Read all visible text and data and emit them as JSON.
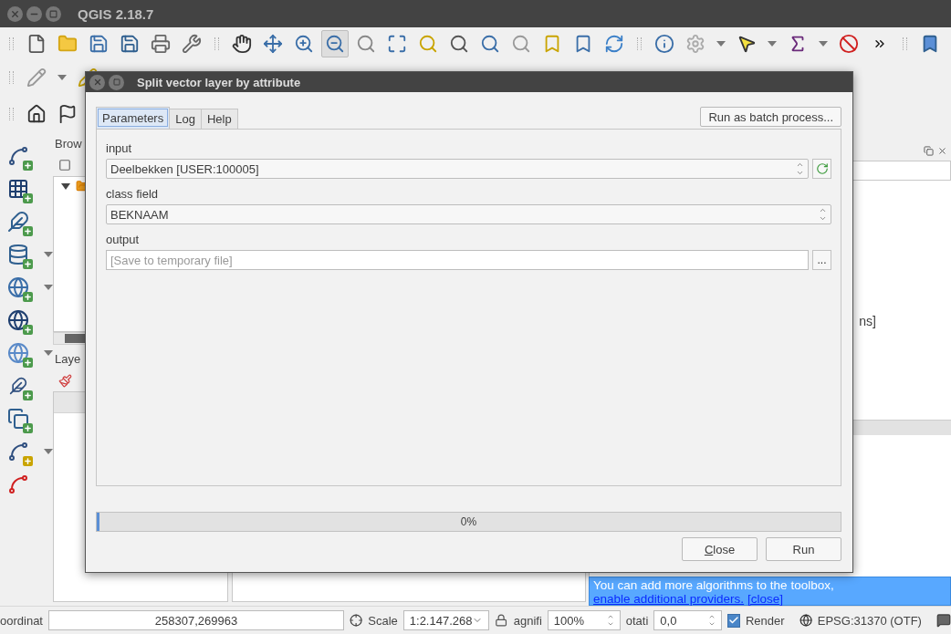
{
  "window": {
    "title": "QGIS 2.18.7"
  },
  "main_toolbar": {
    "tools": [
      {
        "selected": false
      },
      {
        "selected": false
      },
      {
        "selected": false
      },
      {
        "selected": false
      },
      {
        "selected": false
      },
      {
        "selected": false
      },
      {
        "selected": false
      },
      {
        "selected": false
      },
      {
        "selected": false
      },
      {
        "selected": true
      },
      {
        "selected": false
      },
      {
        "selected": false
      },
      {
        "selected": false
      },
      {
        "selected": false
      },
      {
        "selected": false
      },
      {
        "selected": false
      },
      {
        "selected": false
      },
      {
        "selected": false
      },
      {
        "selected": false
      },
      {
        "selected": false
      },
      {
        "selected": false
      },
      {
        "selected": false
      },
      {
        "selected": false
      },
      {
        "selected": false
      },
      {
        "selected": false
      }
    ]
  },
  "browser_panel": {
    "title": "Brow"
  },
  "layers_panel": {
    "title": "Laye"
  },
  "right_panel": {
    "text": "ns]",
    "message": {
      "text": "You can add more algorithms to the toolbox, ",
      "link": "enable additional providers.",
      "close": "[close]"
    }
  },
  "dialog": {
    "title": "Split vector layer by attribute",
    "tabs": [
      {
        "label": "Parameters",
        "selected": true
      },
      {
        "label": "Log",
        "selected": false
      },
      {
        "label": "Help",
        "selected": false
      }
    ],
    "batch_button": "Run as batch process...",
    "parameters": [
      {
        "kind": "layer",
        "label": "input",
        "value": "Deelbekken [USER:100005]"
      },
      {
        "kind": "field",
        "label": "class field",
        "value": "BEKNAAM"
      },
      {
        "kind": "output",
        "label": "output",
        "placeholder": "[Save to temporary file]",
        "button": "..."
      }
    ],
    "progress": {
      "level": 0,
      "text": "0%"
    },
    "buttons": [
      "Close",
      "Run"
    ]
  },
  "status_bar": {
    "coordinate_label": "oordinat",
    "coordinate": "258307,269963",
    "scale_label": "Scale",
    "scale": "1:2.147.268",
    "magnifier_label": "agnifi",
    "magnifier": "100%",
    "rotation_label": "otati",
    "rotation": "0,0",
    "render": {
      "label": "Render",
      "checked": true
    },
    "crs": "EPSG:31370 (OTF)"
  }
}
